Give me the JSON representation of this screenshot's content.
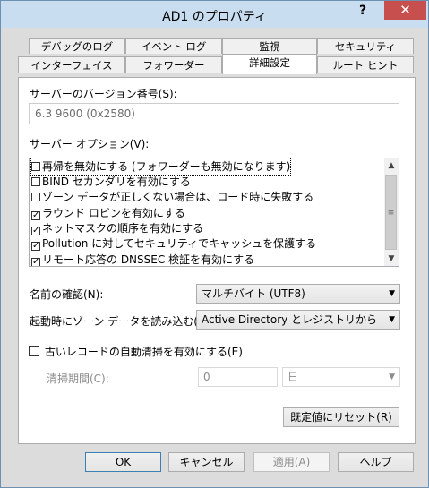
{
  "window": {
    "title": "AD1 のプロパティ",
    "help_glyph": "?",
    "close_glyph": "✕"
  },
  "tabs_row1": [
    {
      "label": "デバッグのログ"
    },
    {
      "label": "イベント ログ"
    },
    {
      "label": "監視"
    },
    {
      "label": "セキュリティ"
    }
  ],
  "tabs_row2": [
    {
      "label": "インターフェイス"
    },
    {
      "label": "フォワーダー"
    },
    {
      "label": "詳細設定",
      "active": true
    },
    {
      "label": "ルート ヒント"
    }
  ],
  "server_version": {
    "label": "サーバーのバージョン番号(S):",
    "value": "6.3 9600 (0x2580)"
  },
  "server_options": {
    "label": "サーバー オプション(V):",
    "items": [
      {
        "label": "再帰を無効にする (フォワーダーも無効になります)",
        "checked": false
      },
      {
        "label": "BIND セカンダリを有効にする",
        "checked": false
      },
      {
        "label": "ゾーン データが正しくない場合は、ロード時に失敗する",
        "checked": false
      },
      {
        "label": "ラウンド ロビンを有効にする",
        "checked": true
      },
      {
        "label": "ネットマスクの順序を有効にする",
        "checked": true
      },
      {
        "label": "Pollution に対してセキュリティでキャッシュを保護する",
        "checked": true
      },
      {
        "label": "リモート応答の DNSSEC 検証を有効にする",
        "checked": true
      }
    ],
    "check_glyph": "✓"
  },
  "name_checking": {
    "label": "名前の確認(N):",
    "value": "マルチバイト (UTF8)"
  },
  "load_zone": {
    "label": "起動時にゾーン データを読み込む(L):",
    "value": "Active Directory とレジストリから"
  },
  "scavenging": {
    "label": "古いレコードの自動清掃を有効にする(E)",
    "checked": false,
    "period_label": "清掃期間(C):",
    "period_value": "0",
    "unit": "日"
  },
  "reset_button": "既定値にリセット(R)",
  "footer": {
    "ok": "OK",
    "cancel": "キャンセル",
    "apply": "適用(A)",
    "help": "ヘルプ"
  }
}
